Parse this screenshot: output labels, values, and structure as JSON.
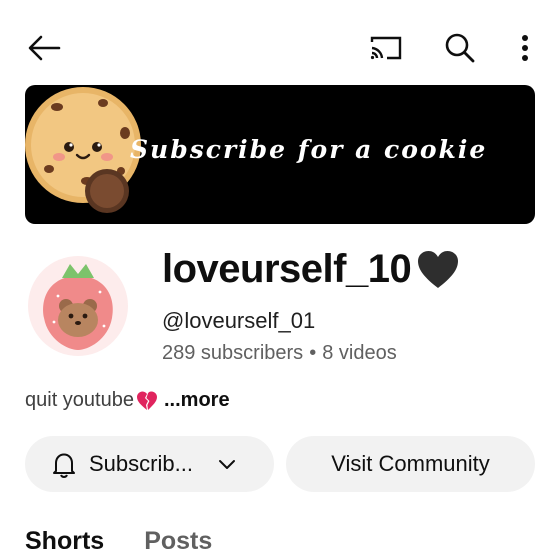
{
  "icons": {
    "back": "arrow-left",
    "cast": "cast",
    "search": "search",
    "more": "more-vertical",
    "bell": "bell",
    "chevron": "chevron-down"
  },
  "banner": {
    "text": "Subscribe for a cookie"
  },
  "channel": {
    "name": "loveurself_10",
    "handle": "@loveurself_01",
    "subscribers": "289 subscribers",
    "separator": "•",
    "videos": "8 videos",
    "description": "quit youtube",
    "more_label": "...more"
  },
  "actions": {
    "subscribe_label": "Subscrib...",
    "community_label": "Visit Community"
  },
  "tabs": [
    {
      "label": "Shorts"
    },
    {
      "label": "Posts"
    }
  ],
  "colors": {
    "pill_bg": "#f2f2f2",
    "banner_bg": "#000000",
    "muted": "#606060"
  }
}
